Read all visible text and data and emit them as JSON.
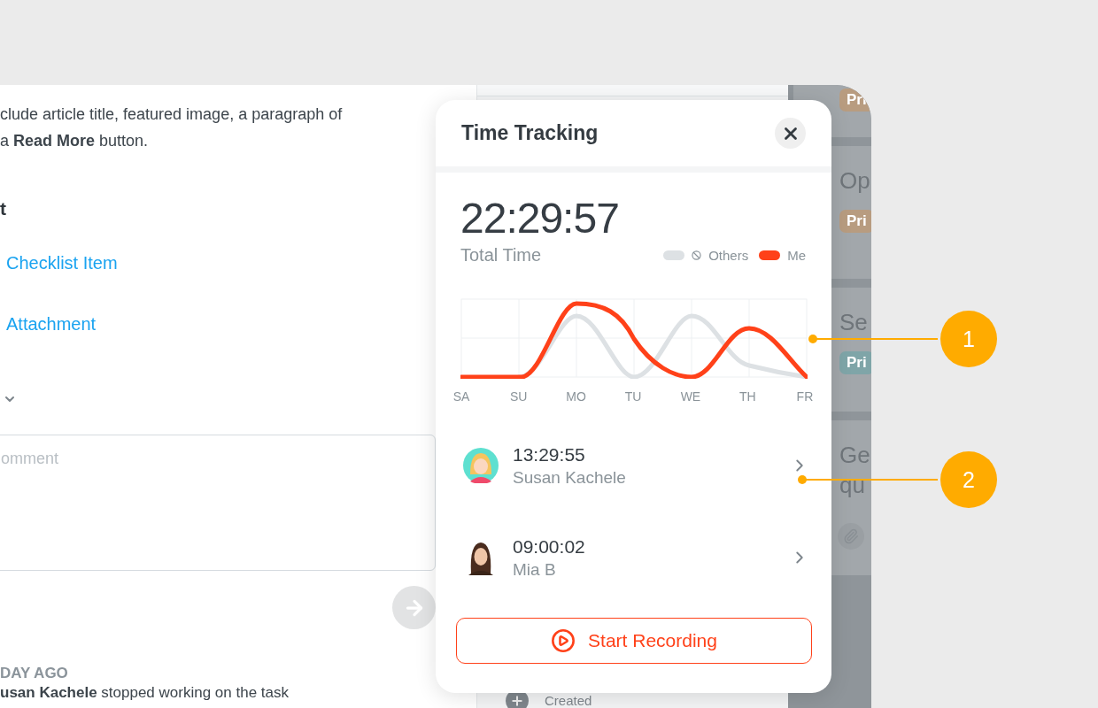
{
  "task": {
    "paragraph": [
      "clude article title, featured image, a paragraph of",
      "a **Read More** button."
    ],
    "heading": "t",
    "links": [
      "Checklist Item",
      "Attachment"
    ],
    "comment": {
      "placeholder": "omment"
    },
    "activity": {
      "date": "DAY AGO",
      "entry": "**usan Kachele** stopped working on the task"
    }
  },
  "timeline": {
    "entry": "Created"
  },
  "board": {
    "cards": [
      {
        "tag": "Pri",
        "color": "#b89c80",
        "attachment": false
      },
      {
        "title": [
          "Op"
        ],
        "tag": "Pri",
        "color": "#b89c80",
        "attachment": false
      },
      {
        "title": [
          "Se"
        ],
        "tag": "Pri",
        "color": "#7fa5a8",
        "attachment": false
      },
      {
        "title": [
          "Ge",
          "qu"
        ],
        "attachment": true
      }
    ]
  },
  "time_tracking": {
    "title": "Time Tracking",
    "total": "22:29:57",
    "total_label": "Total Time",
    "legend": [
      {
        "label": "Others",
        "color": "#dde1e4",
        "hidden": true
      },
      {
        "label": "Me",
        "color": "#ff4119",
        "hidden": false
      }
    ],
    "days": [
      "SA",
      "SU",
      "MO",
      "TU",
      "WE",
      "TH",
      "FR"
    ],
    "people": [
      {
        "time": "13:29:55",
        "name": "Susan Kachele",
        "kind": "cartoon"
      },
      {
        "time": "09:00:02",
        "name": "Mia B",
        "kind": "photo"
      }
    ],
    "button": "Start Recording"
  },
  "callouts": [
    "1",
    "2"
  ]
}
